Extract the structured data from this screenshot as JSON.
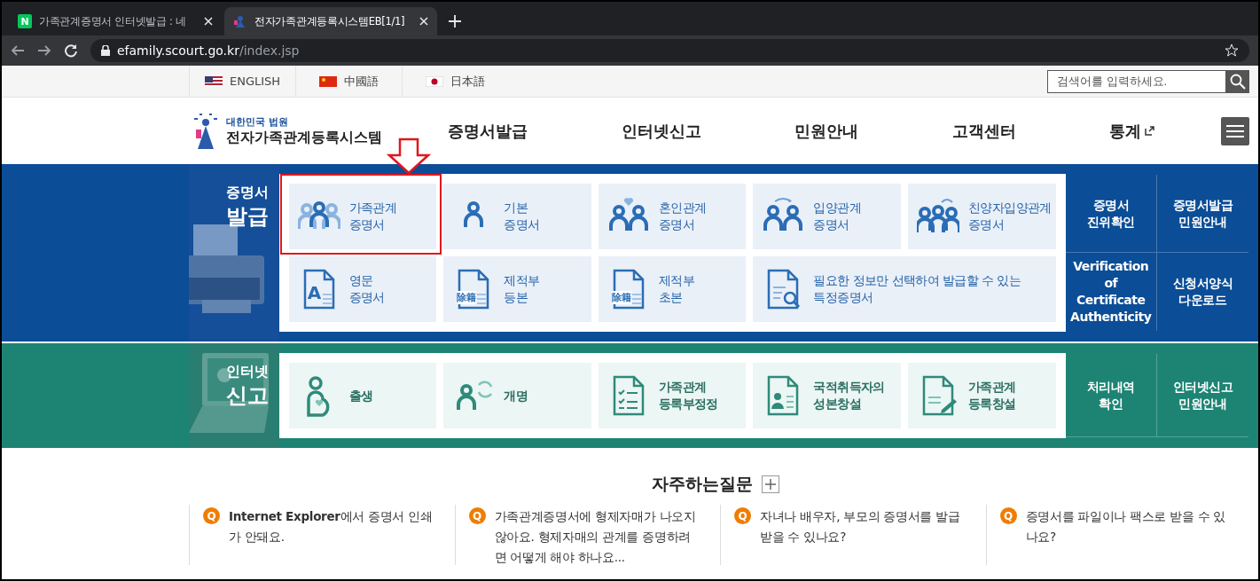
{
  "browser": {
    "tabs": [
      {
        "favicon": "N",
        "title": "가족관계증명서 인터넷발급 : 네",
        "selected": false
      },
      {
        "title": "전자가족관계등록시스템EB[1/1]",
        "selected": true
      }
    ],
    "url_host": "efamily.scourt.go.kr",
    "url_path": "/index.jsp"
  },
  "languages": [
    {
      "label": "ENGLISH"
    },
    {
      "label": "中國語"
    },
    {
      "label": "日本語"
    }
  ],
  "search": {
    "placeholder": "검색어를 입력하세요."
  },
  "logo": {
    "subtitle": "대한민국 법원",
    "title": "전자가족관계등록시스템"
  },
  "nav": [
    {
      "label": "증명서발급",
      "external": false
    },
    {
      "label": "인터넷신고",
      "external": false
    },
    {
      "label": "민원안내",
      "external": false
    },
    {
      "label": "고객센터",
      "external": false
    },
    {
      "label": "통계",
      "external": true
    }
  ],
  "sections": [
    {
      "kind": "certificate",
      "title_top": "증명서",
      "title_main": "발급",
      "cards": [
        {
          "lines": [
            "가족관계",
            "증명서"
          ],
          "highlighted": true,
          "wide": false
        },
        {
          "lines": [
            "기본",
            "증명서"
          ],
          "highlighted": false,
          "wide": false
        },
        {
          "lines": [
            "혼인관계",
            "증명서"
          ],
          "highlighted": false,
          "wide": false
        },
        {
          "lines": [
            "입양관계",
            "증명서"
          ],
          "highlighted": false,
          "wide": false
        },
        {
          "lines": [
            "친양자입양관계",
            "증명서"
          ],
          "highlighted": false,
          "wide": false
        },
        {
          "lines": [
            "영문",
            "증명서"
          ],
          "caption": "A",
          "highlighted": false,
          "wide": false
        },
        {
          "lines": [
            "제적부",
            "등본"
          ],
          "caption": "除籍",
          "highlighted": false,
          "wide": false
        },
        {
          "lines": [
            "제적부",
            "초본"
          ],
          "caption": "除籍",
          "highlighted": false,
          "wide": false
        },
        {
          "lines": [
            "필요한 정보만 선택하여 발급할 수 있는",
            "특정증명서"
          ],
          "highlighted": false,
          "wide": true
        }
      ],
      "links": [
        [
          "증명서",
          "진위확인"
        ],
        [
          "증명서발급",
          "민원안내"
        ],
        [
          "Verification of",
          "Certificate",
          "Authenticity"
        ],
        [
          "신청서양식",
          "다운로드"
        ]
      ]
    },
    {
      "kind": "report",
      "title_top": "인터넷",
      "title_main": "신고",
      "cards": [
        {
          "lines": [
            "출생"
          ],
          "highlighted": false,
          "wide": false
        },
        {
          "lines": [
            "개명"
          ],
          "highlighted": false,
          "wide": false
        },
        {
          "lines": [
            "가족관계",
            "등록부정정"
          ],
          "highlighted": false,
          "wide": false
        },
        {
          "lines": [
            "국적취득자의",
            "성본창설"
          ],
          "highlighted": false,
          "wide": false
        },
        {
          "lines": [
            "가족관계",
            "등록창설"
          ],
          "highlighted": false,
          "wide": false
        }
      ],
      "links": [
        [
          "처리내역",
          "확인"
        ],
        [
          "인터넷신고",
          "민원안내"
        ]
      ]
    }
  ],
  "faq": {
    "title": "자주하는질문",
    "items": [
      {
        "marker": "Q",
        "text": "**Internet Explorer**에서 증명서 인쇄가 안돼요."
      },
      {
        "marker": "Q",
        "text": "가족관계증명서에 형제자매가 나오지 않아요. 형제자매의 관계를 증명하려면 어떻게 해야 하나요..."
      },
      {
        "marker": "Q",
        "text": "자녀나 배우자, 부모의 증명서를 발급 받을 수 있나요?"
      },
      {
        "marker": "Q",
        "text": "증명서를 파일이나 팩스로 받을 수 있나요?"
      }
    ]
  }
}
